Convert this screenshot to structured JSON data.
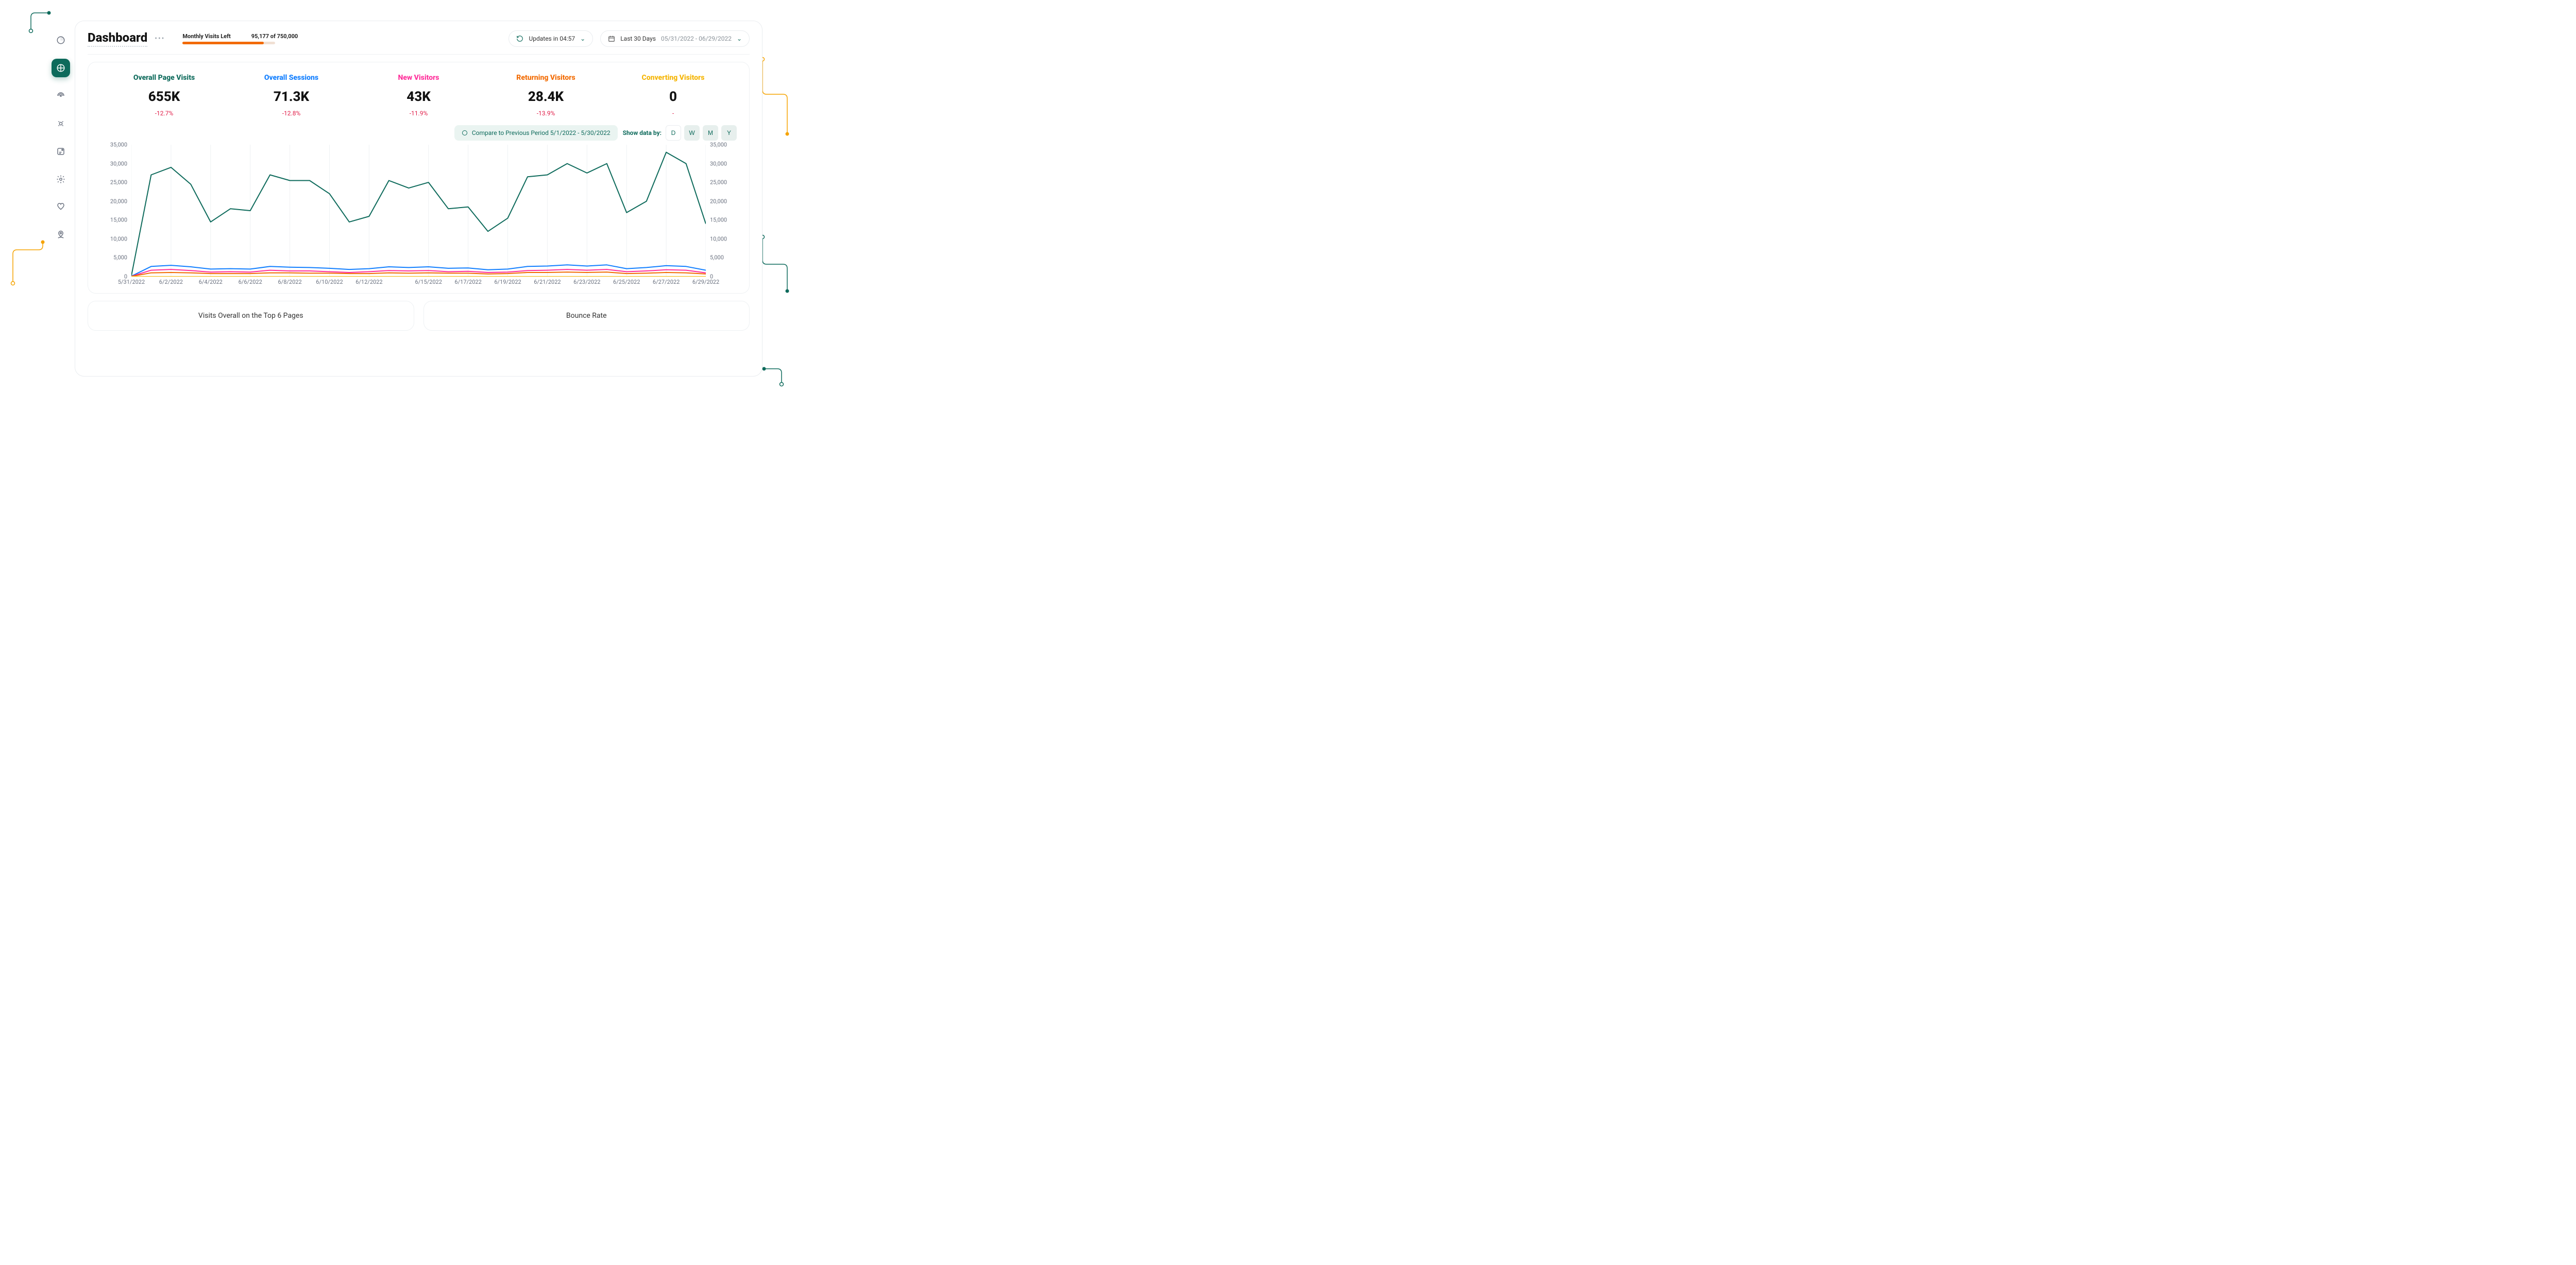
{
  "page": {
    "title": "Dashboard"
  },
  "quota": {
    "label": "Monthly Visits Left",
    "valueText": "95,177 of 750,000",
    "used": 654823,
    "total": 750000
  },
  "updates": {
    "label": "Updates in 04:57"
  },
  "dateRange": {
    "label": "Last 30 Days",
    "range": "05/31/2022 - 06/29/2022"
  },
  "kpis": [
    {
      "label": "Overall Page Visits",
      "value": "655K",
      "delta": "-12.7%",
      "colorClass": "c-green"
    },
    {
      "label": "Overall Sessions",
      "value": "71.3K",
      "delta": "-12.8%",
      "colorClass": "c-blue"
    },
    {
      "label": "New Visitors",
      "value": "43K",
      "delta": "-11.9%",
      "colorClass": "c-pink"
    },
    {
      "label": "Returning Visitors",
      "value": "28.4K",
      "delta": "-13.9%",
      "colorClass": "c-orange"
    },
    {
      "label": "Converting Visitors",
      "value": "0",
      "delta": "-",
      "colorClass": "c-amber"
    }
  ],
  "compare": {
    "text": "Compare to Previous Period 5/1/2022 - 5/30/2022"
  },
  "showby": {
    "label": "Show data by:",
    "options": {
      "d": "D",
      "w": "W",
      "m": "M",
      "y": "Y"
    }
  },
  "subcards": {
    "topPages": "Visits Overall on the Top 6 Pages",
    "bounce": "Bounce Rate"
  },
  "chart_data": {
    "type": "line",
    "xlabel": "",
    "ylabel": "",
    "ylim": [
      0,
      35000
    ],
    "x_ticks": [
      "5/31/2022",
      "6/2/2022",
      "6/4/2022",
      "6/6/2022",
      "6/8/2022",
      "6/10/2022",
      "6/12/2022",
      "6/15/2022",
      "6/17/2022",
      "6/19/2022",
      "6/21/2022",
      "6/23/2022",
      "6/25/2022",
      "6/27/2022",
      "6/29/2022"
    ],
    "y_ticks": [
      0,
      5000,
      10000,
      15000,
      20000,
      25000,
      30000,
      35000
    ],
    "y_tick_labels": [
      "0",
      "5,000",
      "10,000",
      "15,000",
      "20,000",
      "25,000",
      "30,000",
      "35,000"
    ],
    "categories": [
      "5/31/2022",
      "6/1/2022",
      "6/2/2022",
      "6/3/2022",
      "6/4/2022",
      "6/5/2022",
      "6/6/2022",
      "6/7/2022",
      "6/8/2022",
      "6/9/2022",
      "6/10/2022",
      "6/11/2022",
      "6/12/2022",
      "6/13/2022",
      "6/14/2022",
      "6/15/2022",
      "6/16/2022",
      "6/17/2022",
      "6/18/2022",
      "6/19/2022",
      "6/20/2022",
      "6/21/2022",
      "6/22/2022",
      "6/23/2022",
      "6/24/2022",
      "6/25/2022",
      "6/26/2022",
      "6/27/2022",
      "6/28/2022",
      "6/29/2022"
    ],
    "series": [
      {
        "name": "Overall Page Visits",
        "color": "#0d6a5b",
        "values": [
          200,
          27000,
          29000,
          24500,
          14500,
          18000,
          17500,
          27000,
          25500,
          25500,
          22000,
          14500,
          16000,
          25500,
          23500,
          25000,
          18000,
          18500,
          12000,
          15500,
          26500,
          27000,
          30000,
          27500,
          30000,
          17000,
          20000,
          33000,
          30000,
          14000
        ]
      },
      {
        "name": "Overall Sessions",
        "color": "#0f7dff",
        "values": [
          100,
          2700,
          3000,
          2600,
          2000,
          2100,
          2000,
          2700,
          2500,
          2400,
          2200,
          1900,
          2100,
          2600,
          2400,
          2600,
          2200,
          2300,
          1800,
          2000,
          2700,
          2800,
          3100,
          2800,
          3100,
          2100,
          2400,
          2900,
          2700,
          1700
        ]
      },
      {
        "name": "New Visitors",
        "color": "#ff2e9a",
        "values": [
          60,
          1700,
          1900,
          1600,
          1200,
          1300,
          1200,
          1700,
          1500,
          1500,
          1300,
          1100,
          1300,
          1600,
          1500,
          1600,
          1300,
          1400,
          1100,
          1200,
          1600,
          1700,
          1900,
          1700,
          1900,
          1300,
          1500,
          1800,
          1700,
          1000
        ]
      },
      {
        "name": "Returning Visitors",
        "color": "#f26a00",
        "values": [
          40,
          1000,
          1100,
          1000,
          800,
          800,
          800,
          1000,
          1000,
          900,
          900,
          800,
          800,
          1000,
          900,
          1000,
          900,
          900,
          700,
          800,
          1100,
          1100,
          1200,
          1100,
          1200,
          800,
          900,
          1100,
          1000,
          700
        ]
      },
      {
        "name": "Converting Visitors",
        "color": "#f5b400",
        "values": [
          0,
          0,
          0,
          0,
          0,
          0,
          0,
          0,
          0,
          0,
          0,
          0,
          0,
          0,
          0,
          0,
          0,
          0,
          0,
          0,
          0,
          0,
          0,
          0,
          0,
          0,
          0,
          0,
          0,
          0
        ]
      }
    ]
  }
}
